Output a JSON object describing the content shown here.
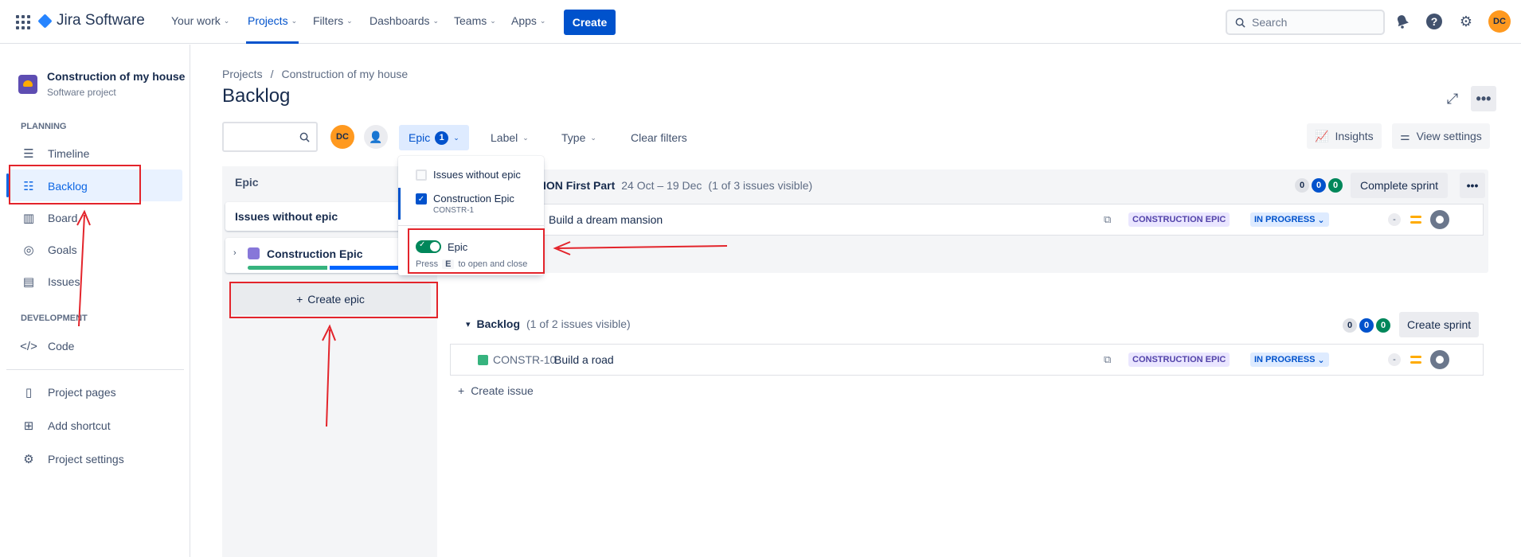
{
  "topnav": {
    "product": "Jira Software",
    "items": [
      "Your work",
      "Projects",
      "Filters",
      "Dashboards",
      "Teams",
      "Apps"
    ],
    "create_label": "Create",
    "search_placeholder": "Search",
    "user_initials": "DC"
  },
  "sidebar": {
    "project_name": "Construction of my house",
    "project_type": "Software project",
    "planning_label": "PLANNING",
    "planning_items": [
      "Timeline",
      "Backlog",
      "Board",
      "Goals",
      "Issues"
    ],
    "development_label": "DEVELOPMENT",
    "development_items": [
      "Code"
    ],
    "footer_items": [
      "Project pages",
      "Add shortcut",
      "Project settings"
    ]
  },
  "breadcrumb": {
    "root": "Projects",
    "separator": "/",
    "project": "Construction of my house"
  },
  "page_title": "Backlog",
  "filters": {
    "avatar_initials": "DC",
    "epic_label": "Epic",
    "epic_count": "1",
    "label_label": "Label",
    "type_label": "Type",
    "clear_label": "Clear filters",
    "insights_label": "Insights",
    "view_settings_label": "View settings"
  },
  "epic_panel": {
    "heading": "Epic",
    "without_epic": "Issues without epic",
    "epic_name": "Construction Epic",
    "create_epic": "Create epic"
  },
  "epic_dropdown": {
    "option_without": "Issues without epic",
    "option_epic_name": "Construction Epic",
    "option_epic_key": "CONSTR-1",
    "toggle_label": "Epic",
    "hint_press": "Press",
    "hint_key": "E",
    "hint_rest": "to open and close"
  },
  "sprint": {
    "name_partial": "ION First Part",
    "dates": "24 Oct – 19 Dec",
    "visible": "(1 of 3 issues visible)",
    "counts": [
      "0",
      "0",
      "0"
    ],
    "complete_label": "Complete sprint",
    "issue_summary": "Build a dream mansion",
    "issue_epic": "CONSTRUCTION EPIC",
    "issue_status": "IN PROGRESS",
    "issue_estimate": "-"
  },
  "backlog": {
    "title": "Backlog",
    "visible": "(1 of 2 issues visible)",
    "counts": [
      "0",
      "0",
      "0"
    ],
    "create_sprint": "Create sprint",
    "issue_key": "CONSTR-10",
    "issue_summary": "Build a road",
    "issue_epic": "CONSTRUCTION EPIC",
    "issue_status": "IN PROGRESS",
    "issue_estimate": "-",
    "create_issue": "Create issue"
  },
  "colors": {
    "brand": "#0052cc",
    "annotation": "#e3242b",
    "epic": "#8777d9"
  }
}
